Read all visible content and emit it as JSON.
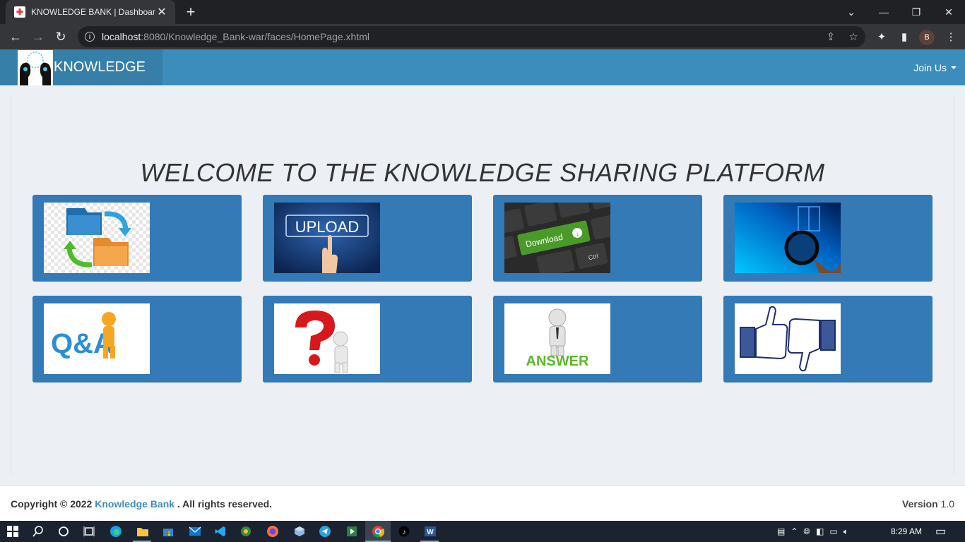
{
  "browser": {
    "tab_title": "KNOWLEDGE BANK | Dashboard",
    "tab_close": "✕",
    "new_tab": "+",
    "url_host": "localhost",
    "url_rest": ":8080/Knowledge_Bank-war/faces/HomePage.xhtml",
    "profile_initial": "B"
  },
  "header": {
    "brand": "KNOWLEDGE",
    "join_us": "Join Us"
  },
  "main": {
    "welcome": "WELCOME TO THE KNOWLEDGE SHARING PLATFORM",
    "tiles": [
      {
        "icon": "folder-sync-icon"
      },
      {
        "icon": "upload-icon",
        "label": "UPLOAD"
      },
      {
        "icon": "download-key-icon",
        "label": "Download",
        "sublabel": "Ctrl"
      },
      {
        "icon": "magnifier-icon"
      },
      {
        "icon": "qa-icon",
        "label": "Q&A"
      },
      {
        "icon": "question-mark-icon"
      },
      {
        "icon": "answer-icon",
        "label": "ANSWER"
      },
      {
        "icon": "thumbs-up-down-icon"
      }
    ]
  },
  "footer": {
    "copyright": "Copyright © 2022",
    "site_name": "Knowledge Bank",
    "rights": ". All rights reserved.",
    "version_label": "Version",
    "version_value": "1.0"
  },
  "taskbar": {
    "time": "8:29 AM"
  },
  "colors": {
    "header": "#3c8dbc",
    "brand_bg": "#367fa9",
    "tile": "#337ab7",
    "content_bg": "#ecf0f5"
  }
}
